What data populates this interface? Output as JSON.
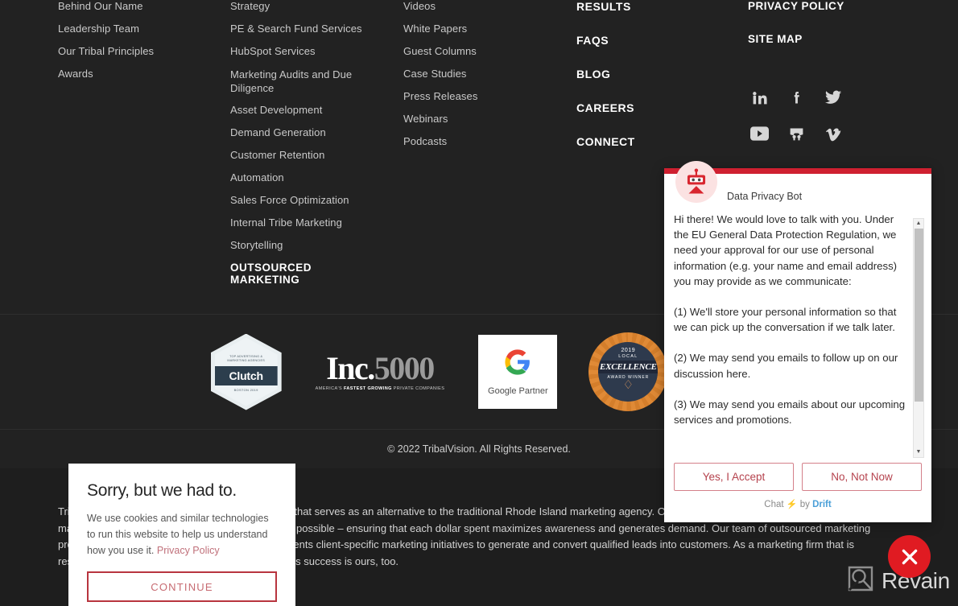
{
  "footer": {
    "columns": {
      "company": {
        "links": [
          "Behind Our Name",
          "Leadership Team",
          "Our Tribal Principles",
          "Awards"
        ]
      },
      "services": {
        "links": [
          "Strategy",
          "PE & Search Fund Services",
          "HubSpot Services",
          "Marketing Audits and Due Diligence",
          "Asset Development",
          "Demand Generation",
          "Customer Retention",
          "Automation",
          "Sales Force Optimization",
          "Internal Tribe Marketing",
          "Storytelling"
        ],
        "heading": "OUTSOURCED MARKETING"
      },
      "resources": {
        "links": [
          "Videos",
          "White Papers",
          "Guest Columns",
          "Case Studies",
          "Press Releases",
          "Webinars",
          "Podcasts"
        ]
      },
      "primary": {
        "headings": [
          "RESULTS",
          "FAQS",
          "BLOG",
          "CAREERS",
          "CONNECT"
        ]
      },
      "legal": {
        "headings": [
          "PRIVACY POLICY",
          "SITE MAP"
        ],
        "social": [
          {
            "name": "linkedin-icon",
            "label": "LinkedIn"
          },
          {
            "name": "facebook-icon",
            "label": "Facebook"
          },
          {
            "name": "twitter-icon",
            "label": "Twitter"
          },
          {
            "name": "youtube-icon",
            "label": "YouTube"
          },
          {
            "name": "slideshare-icon",
            "label": "SlideShare"
          },
          {
            "name": "vimeo-icon",
            "label": "Vimeo"
          }
        ]
      }
    },
    "badges": {
      "clutch": {
        "top_text": "TOP ADVERTISING & MARKETING AGENCIES",
        "name": "Clutch",
        "bottom_text": "BOSTON 2019"
      },
      "inc": {
        "prefix": "Inc.",
        "number": "5000",
        "subtitle_pre": "AMERICA'S ",
        "subtitle_bold": "FASTEST GROWING",
        "subtitle_post": " PRIVATE COMPANIES"
      },
      "google": {
        "label": "Google Partner"
      },
      "excellence": {
        "year": "2019",
        "local": "LOCAL",
        "title": "EXCELLENCE",
        "winner": "AWARD WINNER"
      }
    },
    "copyright": "© 2022 TribalVision. All Rights Reserved.",
    "description": "TribalVision is an outsourced digital marketing firm that serves as an alternative to the traditional Rhode Island marketing agency. Our mission is to deploy our clients' digital marketing budgets as efficiently and intelligently as possible – ensuring that each dollar spent maximizes awareness and generates demand. Our team of outsourced marketing professionals cost-effectively develops and implements client-specific marketing initiatives to generate and convert qualified leads into customers. As a marketing firm that is responsible for new business generation, our client's success is ours, too."
  },
  "cookie_banner": {
    "title": "Sorry, but we had to.",
    "body_pre": "We use cookies and similar technologies to run this website to help us understand how you use it. ",
    "privacy_link": "Privacy Policy",
    "continue_label": "CONTINUE"
  },
  "chat_widget": {
    "bot_name": "Data Privacy Bot",
    "message_paragraphs": [
      "Hi there! We would love to talk with you. Under the EU General Data Protection Regulation, we need your approval for our use of personal information (e.g. your name and email address) you may provide as we communicate:",
      "(1) We'll store your personal information so that we can pick up the conversation if we talk later.",
      "(2) We may send you emails to follow up on our discussion here.",
      "(3) We may send you emails about our upcoming services and promotions."
    ],
    "accept_label": "Yes, I Accept",
    "decline_label": "No, Not Now",
    "footer_chat": "Chat",
    "footer_by": "by",
    "footer_brand": "Drift"
  },
  "watermark": {
    "label": "Revain"
  },
  "colors": {
    "page_background": "#222222",
    "description_background": "#1e1e1e",
    "accent_red": "#cf2030",
    "fab_red": "#e01b22",
    "cookie_border": "#b8353f",
    "chat_button_border": "#d4808a",
    "link_grey": "#c9c9c9",
    "drift_blue": "#4a9fd8"
  }
}
